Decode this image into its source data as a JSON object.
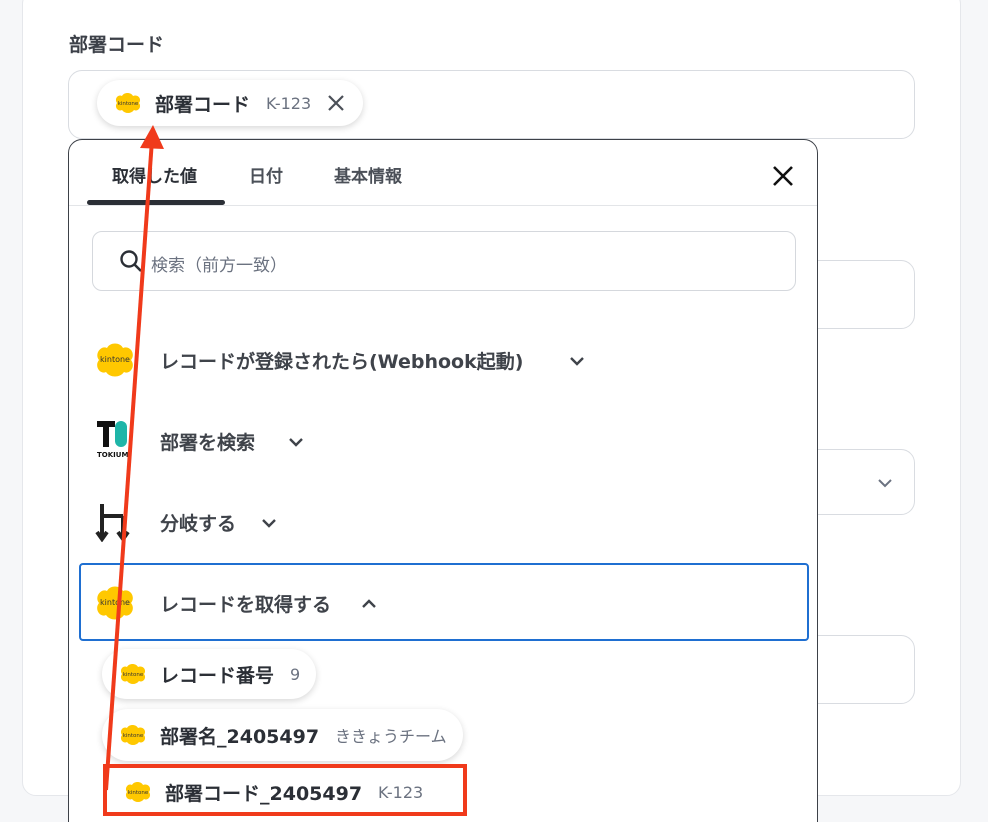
{
  "form": {
    "field_label": "部署コード",
    "selected_chip": {
      "name": "部署コード",
      "value": "K-123"
    }
  },
  "picker": {
    "tabs": [
      "取得した値",
      "日付",
      "基本情報"
    ],
    "search_placeholder": "検索（前方一致）",
    "steps": [
      {
        "label": "レコードが登録されたら(Webhook起動)",
        "app": "kintone",
        "expanded": false
      },
      {
        "label": "部署を検索",
        "app": "TOKIUM",
        "expanded": false
      },
      {
        "label": "分岐する",
        "app": "branch",
        "expanded": false
      },
      {
        "label": "レコードを取得する",
        "app": "kintone",
        "expanded": true
      }
    ],
    "values": [
      {
        "name": "レコード番号",
        "value": "9"
      },
      {
        "name": "部署名_2405497",
        "value": "ききょうチーム"
      },
      {
        "name": "部署コード_2405497",
        "value": "K-123"
      }
    ]
  },
  "logos": {
    "kintone_text": "kintone",
    "tokium_text": "TOKIUM"
  },
  "colors": {
    "kintone_yellow": "#ffc800",
    "highlight_red": "#f03a1b",
    "active_blue": "#1f6fd1",
    "text_dark": "#2b2f36"
  }
}
